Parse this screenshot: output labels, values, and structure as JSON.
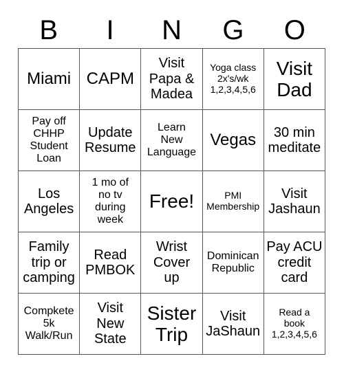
{
  "card": {
    "header_letters": [
      "B",
      "I",
      "N",
      "G",
      "O"
    ],
    "free_space_label": "Free!",
    "colors": {
      "text": "#000000",
      "grid_line": "#555555",
      "background": "#ffffff"
    },
    "grid": {
      "columns": 5,
      "rows": 5,
      "cells": [
        {
          "text": "Miami",
          "size": "fs-lg"
        },
        {
          "text": "CAPM",
          "size": "fs-lg"
        },
        {
          "text": "Visit\nPapa &\nMadea",
          "size": "fs-md"
        },
        {
          "text": "Yoga class\n2x's/wk\n1,2,3,4,5,6",
          "size": "fs-xs"
        },
        {
          "text": "Visit\nDad",
          "size": "fs-xl"
        },
        {
          "text": "Pay off\nCHHP\nStudent\nLoan",
          "size": "fs-sm"
        },
        {
          "text": "Update\nResume",
          "size": "fs-md"
        },
        {
          "text": "Learn\nNew\nLanguage",
          "size": "fs-sm"
        },
        {
          "text": "Vegas",
          "size": "fs-lg"
        },
        {
          "text": "30 min\nmeditate",
          "size": "fs-md"
        },
        {
          "text": "Los\nAngeles",
          "size": "fs-md"
        },
        {
          "text": "1 mo of\nno tv\nduring\nweek",
          "size": "fs-sm"
        },
        {
          "text": "Free!",
          "size": "fs-xl"
        },
        {
          "text": "PMI\nMembership",
          "size": "fs-xs"
        },
        {
          "text": "Visit\nJashaun",
          "size": "fs-md"
        },
        {
          "text": "Family\ntrip or\ncamping",
          "size": "fs-md"
        },
        {
          "text": "Read\nPMBOK",
          "size": "fs-md"
        },
        {
          "text": "Wrist\nCover\nup",
          "size": "fs-md"
        },
        {
          "text": "Dominican\nRepublic",
          "size": "fs-sm"
        },
        {
          "text": "Pay ACU\ncredit\ncard",
          "size": "fs-md"
        },
        {
          "text": "Compkete\n5k\nWalk/Run",
          "size": "fs-sm"
        },
        {
          "text": "Visit\nNew\nState",
          "size": "fs-md"
        },
        {
          "text": "Sister\nTrip",
          "size": "fs-xl"
        },
        {
          "text": "Visit\nJaShaun",
          "size": "fs-md"
        },
        {
          "text": "Read a\nbook\n1,2,3,4,5,6",
          "size": "fs-xs"
        }
      ]
    }
  }
}
